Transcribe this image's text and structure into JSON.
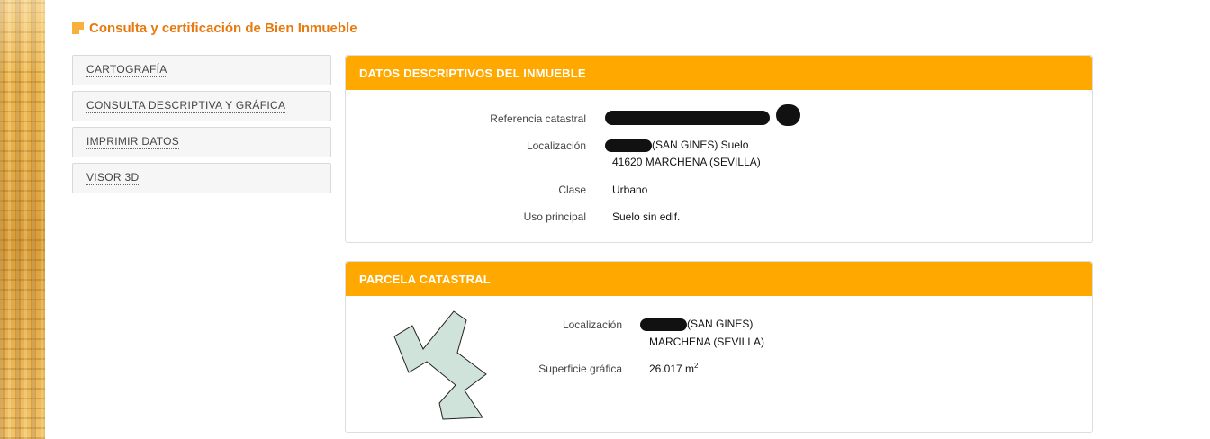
{
  "page": {
    "title": "Consulta y certificación de Bien Inmueble"
  },
  "nav": {
    "items": [
      {
        "label": "CARTOGRAFÍA"
      },
      {
        "label": "CONSULTA DESCRIPTIVA Y GRÁFICA"
      },
      {
        "label": "IMPRIMIR DATOS"
      },
      {
        "label": "VISOR 3D"
      }
    ]
  },
  "datos": {
    "header": "DATOS DESCRIPTIVOS DEL INMUEBLE",
    "ref_label": "Referencia catastral",
    "loc_label": "Localización",
    "loc_line1_suffix": "(SAN GINES) Suelo",
    "loc_line2": "41620 MARCHENA (SEVILLA)",
    "clase_label": "Clase",
    "clase_value": "Urbano",
    "uso_label": "Uso principal",
    "uso_value": "Suelo sin edif."
  },
  "parcela": {
    "header": "PARCELA CATASTRAL",
    "loc_label": "Localización",
    "loc_line1_suffix": "(SAN GINES)",
    "loc_line2": "MARCHENA (SEVILLA)",
    "sup_label": "Superficie gráfica",
    "sup_value": "26.017 m",
    "sup_unit_exp": "2"
  },
  "colors": {
    "accent": "#ffa800",
    "title": "#e8790e",
    "parcel_fill": "#cfe3da"
  }
}
